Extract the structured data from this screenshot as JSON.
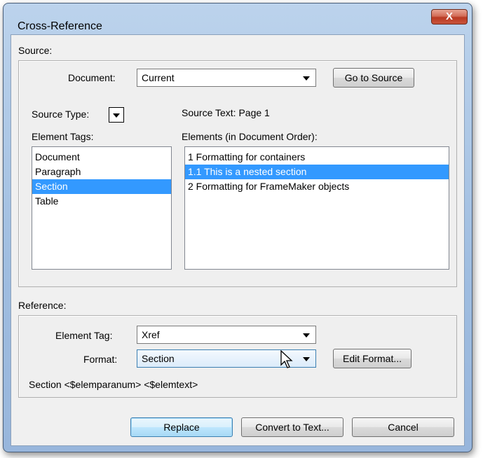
{
  "window": {
    "title": "Cross-Reference",
    "close_label": "X"
  },
  "source": {
    "label": "Source:",
    "document_label": "Document:",
    "document_value": "Current",
    "goto_button": "Go to Source",
    "source_type_label": "Source Type:",
    "source_text_label": "Source Text:",
    "source_text_value": "Page  1",
    "element_tags_label": "Element Tags:",
    "element_tags": [
      {
        "label": "Document",
        "selected": false
      },
      {
        "label": "Paragraph",
        "selected": false
      },
      {
        "label": "Section",
        "selected": true
      },
      {
        "label": "Table",
        "selected": false
      }
    ],
    "elements_label": "Elements (in Document Order):",
    "elements": [
      {
        "label": "1 Formatting for containers",
        "selected": false
      },
      {
        "label": "1.1 This is a nested section",
        "selected": true
      },
      {
        "label": "2 Formatting for FrameMaker objects",
        "selected": false
      }
    ]
  },
  "reference": {
    "label": "Reference:",
    "element_tag_label": "Element Tag:",
    "element_tag_value": "Xref",
    "format_label": "Format:",
    "format_value": "Section",
    "edit_format_button": "Edit Format...",
    "format_string": "Section <$elemparanum> <$elemtext>"
  },
  "buttons": {
    "replace": "Replace",
    "convert": "Convert to Text...",
    "cancel": "Cancel"
  }
}
